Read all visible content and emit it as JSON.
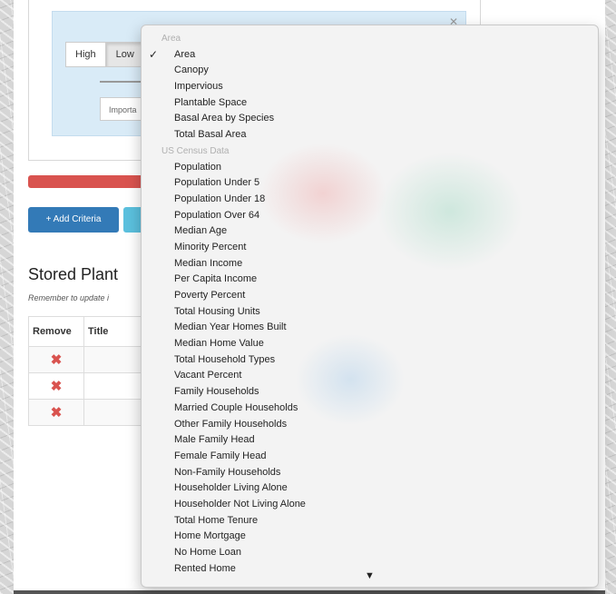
{
  "criteria": {
    "close_mark": "✕",
    "high_label": "High",
    "low_label": "Low",
    "importance_label": "Importa"
  },
  "toolbar": {
    "add_criteria_label": "+ Add Criteria"
  },
  "stored_plans": {
    "title": "Stored Plant",
    "reminder": "Remember to update i",
    "columns": [
      "Remove",
      "Title"
    ],
    "remove_icon": "✖"
  },
  "dropdown": {
    "checkmark": "✓",
    "scroll_arrow": "▼",
    "groups": [
      {
        "label": "Area",
        "options": [
          "Area",
          "Canopy",
          "Impervious",
          "Plantable Space",
          "Basal Area by Species",
          "Total Basal Area"
        ],
        "selected": "Area"
      },
      {
        "label": "US Census Data",
        "options": [
          "Population",
          "Population Under 5",
          "Population Under 18",
          "Population Over 64",
          "Median Age",
          "Minority Percent",
          "Median Income",
          "Per Capita Income",
          "Poverty Percent",
          "Total Housing Units",
          "Median Year Homes Built",
          "Median Home Value",
          "Total Household Types",
          "Vacant Percent",
          "Family Households",
          "Married Couple Households",
          "Other Family Households",
          "Male Family Head",
          "Female Family Head",
          "Non-Family Households",
          "Householder Living Alone",
          "Householder Not Living Alone",
          "Total Home Tenure",
          "Home Mortgage",
          "No Home Loan",
          "Rented Home"
        ]
      }
    ]
  },
  "colors": {
    "primary": "#337ab7",
    "danger": "#d9534f",
    "info": "#5bc0de",
    "criteria_bg": "#d9ebf7"
  }
}
